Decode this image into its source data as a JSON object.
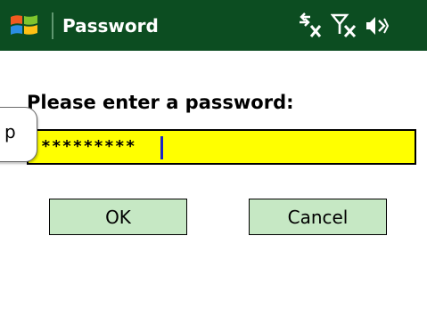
{
  "window": {
    "title": "Password"
  },
  "status_icons": [
    "connectivity-disabled-icon",
    "signal-off-icon",
    "volume-off-icon"
  ],
  "prompt": {
    "label": "Please enter a password:"
  },
  "password_field": {
    "value": "*********"
  },
  "sip_tab": {
    "label": "p"
  },
  "buttons": {
    "ok_label": "OK",
    "cancel_label": "Cancel"
  },
  "colors": {
    "titlebar": "#0c4d21",
    "field_background": "#ffff00",
    "button_background": "#c6e8c4",
    "caret": "#1a24c8"
  }
}
